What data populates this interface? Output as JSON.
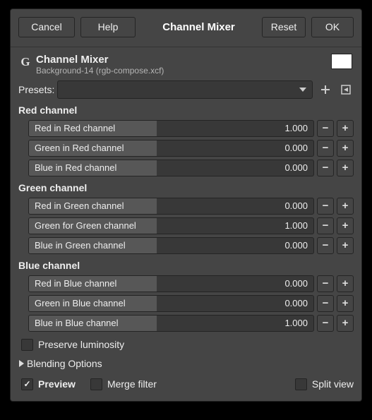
{
  "buttons": {
    "cancel": "Cancel",
    "help": "Help",
    "title": "Channel Mixer",
    "reset": "Reset",
    "ok": "OK"
  },
  "header": {
    "icon": "G",
    "title": "Channel Mixer",
    "sub": "Background-14 (rgb-compose.xcf)",
    "swatch": "#ffffff"
  },
  "presets": {
    "label": "Presets:"
  },
  "sections": {
    "red": {
      "title": "Red channel",
      "rows": [
        {
          "name": "Red in Red channel",
          "value": "1.000",
          "fill": 45
        },
        {
          "name": "Green in Red channel",
          "value": "0.000",
          "fill": 45
        },
        {
          "name": "Blue in Red channel",
          "value": "0.000",
          "fill": 45
        }
      ]
    },
    "green": {
      "title": "Green channel",
      "rows": [
        {
          "name": "Red in Green channel",
          "value": "0.000",
          "fill": 45
        },
        {
          "name": "Green for Green channel",
          "value": "1.000",
          "fill": 45
        },
        {
          "name": "Blue in Green channel",
          "value": "0.000",
          "fill": 45
        }
      ]
    },
    "blue": {
      "title": "Blue channel",
      "rows": [
        {
          "name": "Red in Blue channel",
          "value": "0.000",
          "fill": 45
        },
        {
          "name": "Green in Blue channel",
          "value": "0.000",
          "fill": 45
        },
        {
          "name": "Blue in Blue channel",
          "value": "1.000",
          "fill": 45
        }
      ]
    }
  },
  "preserve": "Preserve luminosity",
  "blending": "Blending Options",
  "footer": {
    "preview": "Preview",
    "merge": "Merge filter",
    "split": "Split view"
  },
  "step": {
    "minus": "−",
    "plus": "+"
  }
}
